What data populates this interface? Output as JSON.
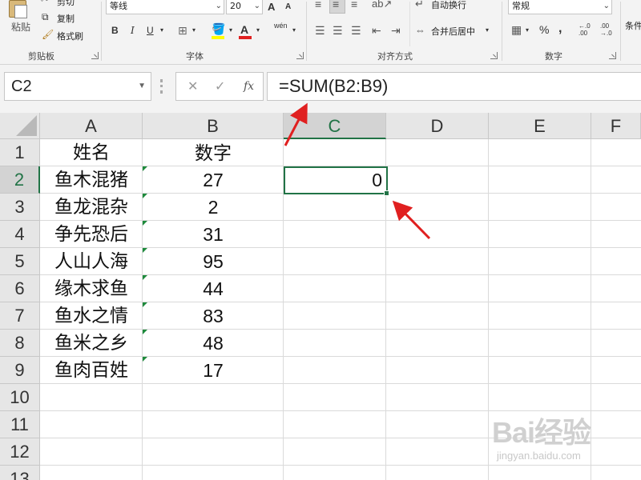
{
  "ribbon": {
    "clipboard": {
      "paste_label": "粘贴",
      "cut_label": "剪切",
      "copy_label": "复制",
      "format_painter_label": "格式刷",
      "group_label": "剪贴板"
    },
    "font": {
      "font_name": "等线",
      "font_size": "20",
      "grow_icon": "A",
      "shrink_icon": "A",
      "bold": "B",
      "italic": "I",
      "underline": "U",
      "phonetic": "wén",
      "group_label": "字体"
    },
    "alignment": {
      "wrap_text_label": "自动换行",
      "merge_center_label": "合并后居中",
      "group_label": "对齐方式"
    },
    "number": {
      "format_value": "常规",
      "percent": "%",
      "comma": ",",
      "increase_decimal": "←.0 .00",
      "decrease_decimal": ".00 →.0",
      "group_label": "数字"
    },
    "overflow_label": "条件"
  },
  "formula_bar": {
    "name_box": "C2",
    "cancel_icon": "✕",
    "enter_icon": "✓",
    "fx_label": "fx",
    "formula": "=SUM(B2:B9)"
  },
  "sheet": {
    "column_headers": [
      "A",
      "B",
      "C",
      "D",
      "E",
      "F"
    ],
    "row_headers": [
      "1",
      "2",
      "3",
      "4",
      "5",
      "6",
      "7",
      "8",
      "9",
      "10",
      "11",
      "12",
      "13"
    ],
    "header_row": {
      "a": "姓名",
      "b": "数字"
    },
    "rows": [
      {
        "a": "鱼木混猪",
        "b": "27"
      },
      {
        "a": "鱼龙混杂",
        "b": "2"
      },
      {
        "a": "争先恐后",
        "b": "31"
      },
      {
        "a": "人山人海",
        "b": "95"
      },
      {
        "a": "缘木求鱼",
        "b": "44"
      },
      {
        "a": "鱼水之情",
        "b": "83"
      },
      {
        "a": "鱼米之乡",
        "b": "48"
      },
      {
        "a": "鱼肉百姓",
        "b": "17"
      }
    ],
    "selected_cell_value": "0",
    "accent_color": "#217346",
    "arrow_color": "#e02020"
  },
  "watermark": {
    "logo": "Bai经验",
    "url": "jingyan.baidu.com"
  }
}
